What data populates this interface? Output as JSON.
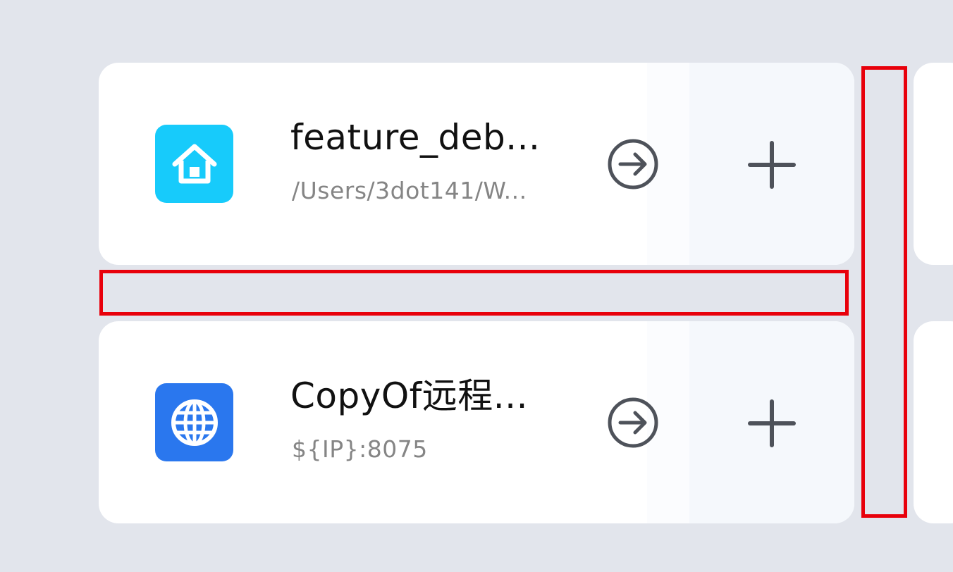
{
  "items": [
    {
      "title": "feature_deb...",
      "subtitle": "/Users/3dot141/W...",
      "icon": "home-icon",
      "icon_color": "#17cbfb"
    },
    {
      "title": "CopyOf远程...",
      "subtitle": "${IP}:8075",
      "icon": "globe-icon",
      "icon_color": "#2a77ee"
    }
  ],
  "actions": {
    "open_icon": "arrow-right-circle-icon",
    "add_icon": "plus-icon"
  },
  "colors": {
    "background": "#e2e5ec",
    "card": "#ffffff",
    "add_pane": "#f5f8fc",
    "highlight": "#e8000b",
    "icon_stroke": "#4e525a"
  }
}
